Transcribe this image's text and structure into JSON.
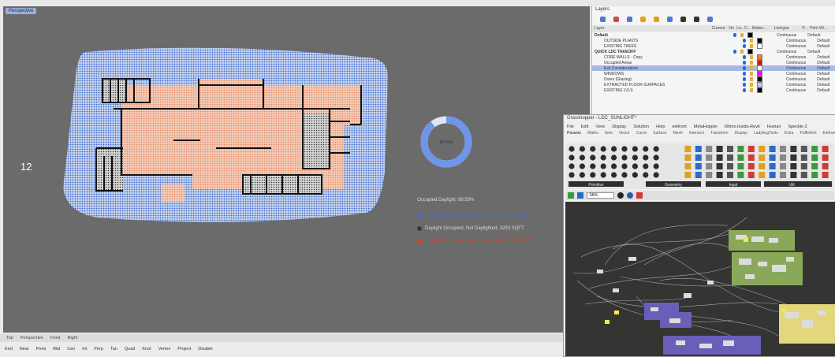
{
  "viewport": {
    "label": "Perspective",
    "floor_number": "12",
    "legend_title": "Occupied Daylight: 89.55%",
    "legend": [
      {
        "text": "Daylight Occupied, Daylighted > 300 , 65.82 SQFT",
        "color": "#3f6fd6"
      },
      {
        "text": "Daylight Occupied, Not Daylighted, 3283 SQFT",
        "color": "#3a3a3a"
      },
      {
        "text": "Daylight Occupied, Unoccupied Glare, 1384 SQFT",
        "color": "#e0401c"
      }
    ],
    "donut_label": "89.55%",
    "donut_value": 0.8955,
    "tabs": [
      "Top",
      "Perspective",
      "Front",
      "Right"
    ],
    "snaps": [
      "End",
      "Near",
      "Point",
      "Mid",
      "Cen",
      "Int",
      "Perp",
      "Tan",
      "Quad",
      "Knot",
      "Vertex",
      "Project",
      "Disable"
    ]
  },
  "layers": {
    "title": "Layers",
    "headers": [
      "Layer",
      "Current",
      "On",
      "Lo...",
      "C...",
      "Materi...",
      "Linetype",
      "P...",
      "Print Wi..."
    ],
    "rows": [
      {
        "name": "Default",
        "indent": 0,
        "color": "#000000",
        "linetype": "Continuous",
        "print": "Default",
        "sel": false
      },
      {
        "name": "OUTSIDE PLANTS",
        "indent": 1,
        "color": "#000000",
        "linetype": "Continuous",
        "print": "Default",
        "sel": false
      },
      {
        "name": "EXISTING TREES",
        "indent": 1,
        "color": "#ffffff",
        "linetype": "Continuous",
        "print": "Default",
        "sel": false
      },
      {
        "name": "QUICK LDC TAKEOFF",
        "indent": 0,
        "color": "#000000",
        "linetype": "Continuous",
        "print": "Default",
        "sel": false
      },
      {
        "name": "CORE WALLS - Copy",
        "indent": 1,
        "color": "#ff7f00",
        "linetype": "Continuous",
        "print": "Default",
        "sel": false
      },
      {
        "name": "Occupied Areas",
        "indent": 1,
        "color": "#ff0000",
        "linetype": "Continuous",
        "print": "Default",
        "sel": false
      },
      {
        "name": "Exit Considerations",
        "indent": 1,
        "color": "#ffffff",
        "linetype": "Continuous",
        "print": "Default",
        "sel": true
      },
      {
        "name": "WINDOWS",
        "indent": 1,
        "color": "#ff00ff",
        "linetype": "Continuous",
        "print": "Default",
        "sel": false
      },
      {
        "name": "Doors (Glazing)",
        "indent": 1,
        "color": "#000000",
        "linetype": "Continuous",
        "print": "Default",
        "sel": false
      },
      {
        "name": "EXTRACTED FLOOR SURFACES",
        "indent": 1,
        "color": "#d0c0ff",
        "linetype": "Continuous",
        "print": "Default",
        "sel": false
      },
      {
        "name": "EXISTING LVLS",
        "indent": 1,
        "color": "#000000",
        "linetype": "Continuous",
        "print": "Default",
        "sel": false
      }
    ]
  },
  "grasshopper": {
    "title": "Grasshopper - LDC_SUNLIGHT*",
    "menu": [
      "File",
      "Edit",
      "View",
      "Display",
      "Solution",
      "Help",
      "elefront",
      "MetaHopper",
      "Rhino.Inside.Revit",
      "Human",
      "Speckle 2"
    ],
    "tabs": [
      "Params",
      "Maths",
      "Sets",
      "Vector",
      "Curve",
      "Surface",
      "Mesh",
      "Intersect",
      "Transform",
      "Display",
      "LadybugTools",
      "Extra",
      "Pufferfish",
      "Elefront",
      "Wb",
      "Kangaroo2"
    ],
    "groups": [
      "Primitive",
      "Geometry",
      "Input",
      "Util"
    ],
    "zoom": "56%"
  },
  "colors": {
    "viewport_bg": "#6b6b6b",
    "daylit": "#3f6fd6",
    "undaylit": "#e8a888",
    "canvas_bg": "#343433",
    "cluster_green": "#8aa85a",
    "cluster_purple": "#6a5fb8",
    "cluster_yellow": "#e2d77a"
  }
}
